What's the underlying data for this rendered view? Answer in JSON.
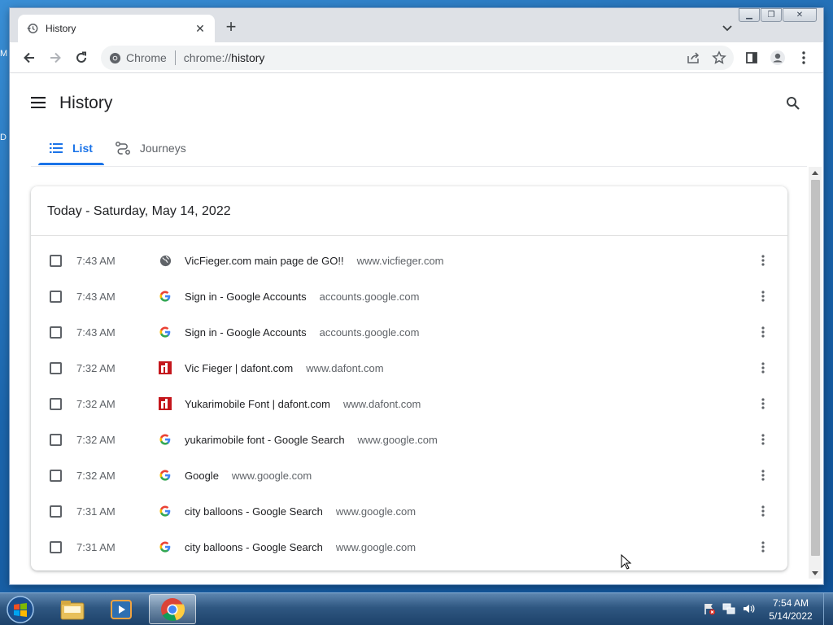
{
  "desktop": {
    "fragment_left_1": "M",
    "fragment_left_2": "D"
  },
  "browser": {
    "tab": {
      "title": "History",
      "close_glyph": "✕"
    },
    "new_tab_glyph": "+",
    "window_buttons": {
      "minimize": "▁",
      "maximize": "❐",
      "close": "✕"
    },
    "omnibox": {
      "site_label": "Chrome",
      "url_scheme": "chrome://",
      "url_path": "history"
    }
  },
  "page": {
    "title": "History",
    "tabs": [
      {
        "label": "List",
        "icon": "list-icon",
        "active": true
      },
      {
        "label": "Journeys",
        "icon": "journeys-icon",
        "active": false
      }
    ],
    "date_header": "Today - Saturday, May 14, 2022",
    "entries": [
      {
        "time": "7:43 AM",
        "title": "VicFieger.com main page de GO!!",
        "domain": "www.vicfieger.com",
        "favicon": "globe-icon"
      },
      {
        "time": "7:43 AM",
        "title": "Sign in - Google Accounts",
        "domain": "accounts.google.com",
        "favicon": "google-icon"
      },
      {
        "time": "7:43 AM",
        "title": "Sign in - Google Accounts",
        "domain": "accounts.google.com",
        "favicon": "google-icon"
      },
      {
        "time": "7:32 AM",
        "title": "Vic Fieger | dafont.com",
        "domain": "www.dafont.com",
        "favicon": "dafont-icon"
      },
      {
        "time": "7:32 AM",
        "title": "Yukarimobile Font | dafont.com",
        "domain": "www.dafont.com",
        "favicon": "dafont-icon"
      },
      {
        "time": "7:32 AM",
        "title": "yukarimobile font - Google Search",
        "domain": "www.google.com",
        "favicon": "google-icon"
      },
      {
        "time": "7:32 AM",
        "title": "Google",
        "domain": "www.google.com",
        "favicon": "google-icon"
      },
      {
        "time": "7:31 AM",
        "title": "city balloons - Google Search",
        "domain": "www.google.com",
        "favicon": "google-icon"
      },
      {
        "time": "7:31 AM",
        "title": "city balloons - Google Search",
        "domain": "www.google.com",
        "favicon": "google-icon"
      }
    ]
  },
  "taskbar": {
    "clock_time": "7:54 AM",
    "clock_date": "5/14/2022",
    "apps": [
      "explorer-icon",
      "media-player-icon",
      "chrome-icon"
    ]
  },
  "colors": {
    "accent": "#1a73e8",
    "text": "#202124",
    "muted": "#5f6368",
    "dafont": "#c4161c"
  }
}
